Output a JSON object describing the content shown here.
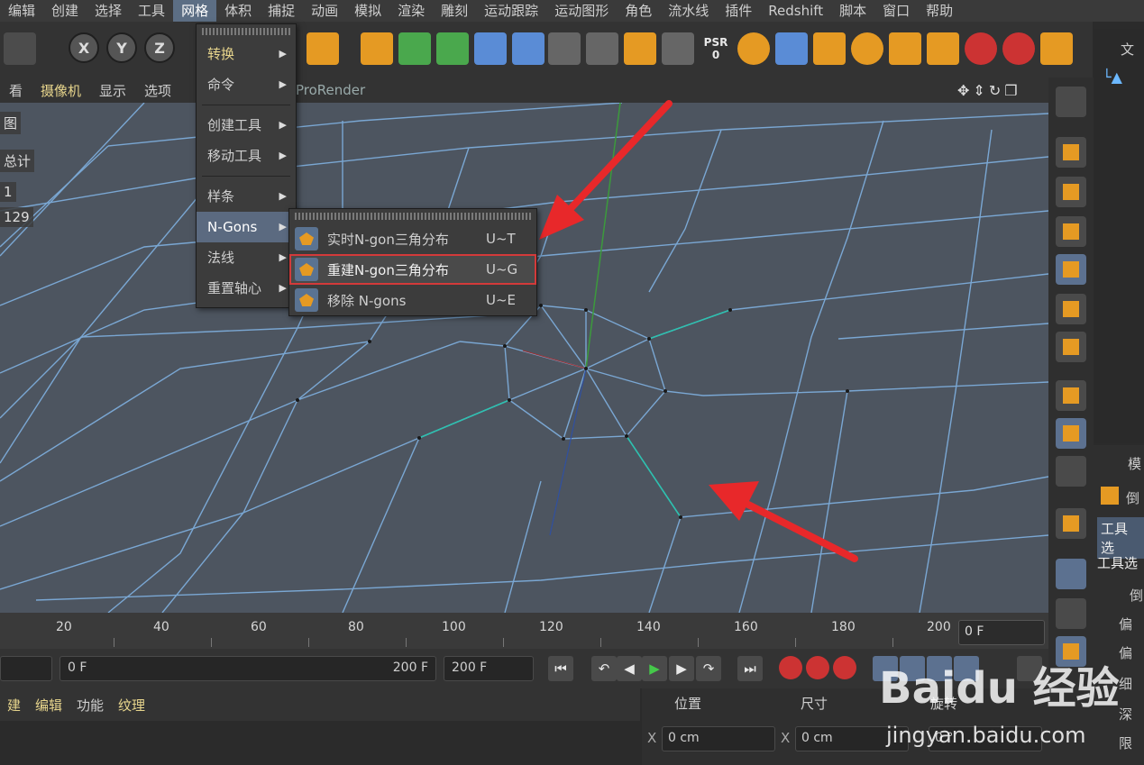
{
  "menubar": {
    "items": [
      "编辑",
      "创建",
      "选择",
      "工具",
      "网格",
      "体积",
      "捕捉",
      "动画",
      "模拟",
      "渲染",
      "雕刻",
      "运动跟踪",
      "运动图形",
      "角色",
      "流水线",
      "插件",
      "Redshift",
      "脚本",
      "窗口",
      "帮助"
    ],
    "active": "网格"
  },
  "toolbar": {
    "axis_x": "X",
    "axis_y": "Y",
    "axis_z": "Z",
    "psr_top": "PSR",
    "psr_bottom": "0"
  },
  "viewbar": {
    "items": [
      "看",
      "摄像机",
      "显示",
      "选项"
    ],
    "render_label": "ProRender"
  },
  "hud": {
    "view_label": "图",
    "total_label": "总计",
    "count_1": "1",
    "count_2": "129"
  },
  "mesh_menu": {
    "items": [
      {
        "label": "转换",
        "arrow": "▶"
      },
      {
        "label": "命令",
        "arrow": "▶"
      },
      {
        "label": "创建工具",
        "arrow": "▶"
      },
      {
        "label": "移动工具",
        "arrow": "▶"
      },
      {
        "label": "样条",
        "arrow": "▶"
      },
      {
        "label": "N-Gons",
        "arrow": "▶"
      },
      {
        "label": "法线",
        "arrow": "▶"
      },
      {
        "label": "重置轴心",
        "arrow": "▶"
      }
    ]
  },
  "ngons_submenu": {
    "items": [
      {
        "label": "实时N-gon三角分布",
        "shortcut": "U~T"
      },
      {
        "label": "重建N-gon三角分布",
        "shortcut": "U~G"
      },
      {
        "label": "移除 N-gons",
        "shortcut": "U~E"
      }
    ]
  },
  "timeline": {
    "ticks": [
      "20",
      "40",
      "60",
      "80",
      "100",
      "120",
      "140",
      "160",
      "180",
      "200"
    ],
    "current_frame": "0 F"
  },
  "playback": {
    "start_field": "0 F",
    "range_end": "200 F",
    "end_field": "200 F"
  },
  "material_bar": {
    "items": [
      "建",
      "编辑",
      "功能",
      "纹理"
    ]
  },
  "coords": {
    "position": "位置",
    "size": "尺寸",
    "rotation": "旋转",
    "axis_x": "X",
    "pos_x": "0 cm",
    "size_x": "0 cm",
    "rot_h": "0 °"
  },
  "right_panel": {
    "tab_top": "文",
    "tab_mid": "模",
    "item_1": "倒",
    "tool_tab_1": "工具选",
    "tool_tab_2": "工具选",
    "attrs": [
      "倒",
      "偏",
      "偏",
      "细",
      "深",
      "限"
    ]
  },
  "watermark": {
    "logo": "Baidu 经验",
    "url": "jingyan.baidu.com"
  },
  "colors": {
    "menu_active": "#5c6e84",
    "highlight_outline": "#d33a3a",
    "annotation_arrow": "#e8282a",
    "viewport_bg": "#4d5560",
    "wire": "#7fb0e0"
  }
}
